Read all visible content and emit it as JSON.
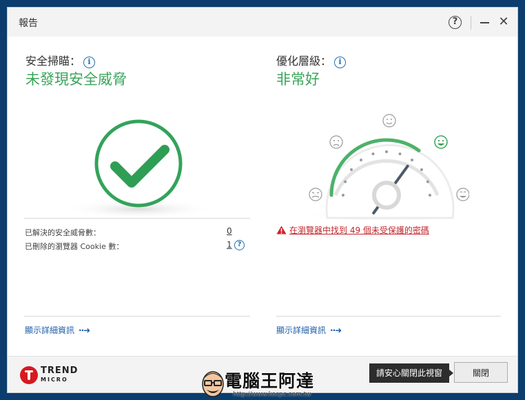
{
  "window": {
    "title": "報告"
  },
  "titlebar": {
    "help_label": "?",
    "close_label": "✕"
  },
  "left_panel": {
    "title": "安全掃瞄：",
    "status": "未發現安全威脅",
    "stats": [
      {
        "label": "已解決的安全威脅數：",
        "value": "0"
      },
      {
        "label": "已刪除的瀏覽器 Cookie 數：",
        "value": "1"
      }
    ],
    "stat_help_label": "?",
    "details_label": "顯示詳細資訊"
  },
  "right_panel": {
    "title": "優化層級：",
    "status": "非常好",
    "gauge_level": 0.7,
    "warning": "在瀏覽器中找到 49 個未受保護的密碼",
    "details_label": "顯示詳細資訊"
  },
  "footer": {
    "brand_name": "TREND",
    "brand_sub": "MICRO",
    "tooltip": "請安心關閉此視窗",
    "close_button": "關閉"
  },
  "watermark": {
    "text": "電腦王阿達",
    "url": "http://www.kocpc.com.tw"
  },
  "colors": {
    "success_green": "#3aa55a",
    "warning_red": "#c1272d",
    "link_blue": "#1f5fa8",
    "brand_red": "#d71920",
    "gauge_green": "#4cb26a"
  }
}
